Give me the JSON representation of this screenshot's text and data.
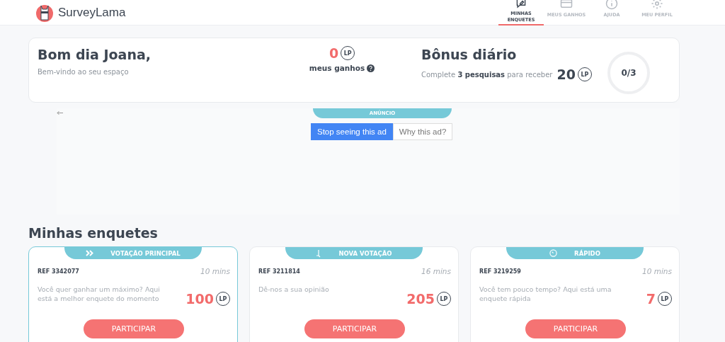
{
  "header": {
    "logo": "SurveyLama",
    "nav": [
      {
        "label": "MINHAS ENQUETES",
        "kind": "chat-edit",
        "selected": true
      },
      {
        "label": "MEUS GANHOS",
        "kind": "card",
        "selected": false
      },
      {
        "label": "AJUDA",
        "kind": "info",
        "selected": false
      },
      {
        "label": "MEU PERFIL",
        "kind": "gear",
        "selected": false
      }
    ]
  },
  "welcome": {
    "title": "Bom dia Joana,",
    "subtitle": "Bem-vindo ao seu espaço",
    "earnings": {
      "amount": "0",
      "unit": "LP",
      "label": "meus ganhos"
    },
    "bonus": {
      "title": "Bônus diário",
      "text": "Complete **3 pesquisas** para receber",
      "amount": "20",
      "unit": "LP",
      "progress": "0/3"
    }
  },
  "ad": {
    "badge": "ANÚNCIO",
    "buttons": [
      "Stop seeing this ad",
      "Why this ad?"
    ]
  },
  "surveys": {
    "title": "Minhas enquetes",
    "items": [
      {
        "kind": "principal",
        "tag": "VOTAÇÃO PRINCIPAL",
        "ref": "REF 3342077",
        "duration": "10 mins",
        "description": "Você quer ganhar um máximo? Aqui está a melhor enquete do momento",
        "points": "100",
        "unit": "LP",
        "button": "PARTICIPAR",
        "selected": true
      },
      {
        "kind": "nova",
        "tag": "NOVA VOTAÇÃO",
        "ref": "REF 3211814",
        "duration": "16 mins",
        "description": "Dê-nos a sua opinião",
        "points": "205",
        "unit": "LP",
        "button": "PARTICIPAR",
        "selected": false
      },
      {
        "kind": "rapido",
        "tag": "RÁPIDO",
        "ref": "REF 3219259",
        "duration": "10 mins",
        "description": "Você tem pouco tempo? Aqui está uma enquete rápida",
        "points": "7",
        "unit": "LP",
        "button": "PARTICIPAR",
        "selected": false
      }
    ]
  }
}
